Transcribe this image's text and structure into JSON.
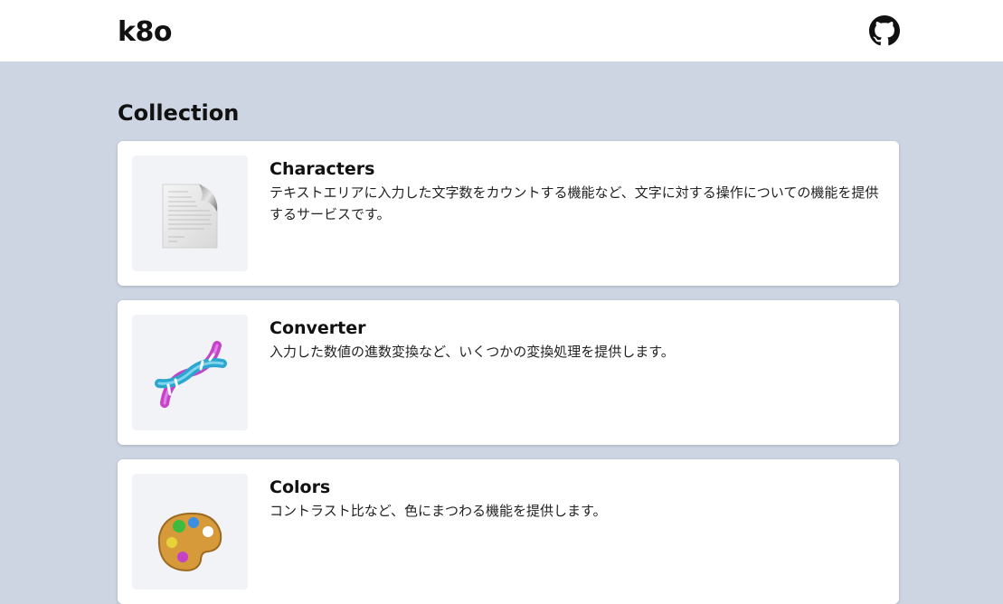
{
  "header": {
    "logo": "k8o",
    "github_icon": "github-icon"
  },
  "main": {
    "section_title": "Collection",
    "cards": [
      {
        "title": "Characters",
        "description": "テキストエリアに入力した文字数をカウントする機能など、文字に対する操作についての機能を提供するサービスです。",
        "icon": "document-icon"
      },
      {
        "title": "Converter",
        "description": "入力した数値の進数変換など、いくつかの変換処理を提供します。",
        "icon": "dna-icon"
      },
      {
        "title": "Colors",
        "description": "コントラスト比など、色にまつわる機能を提供します。",
        "icon": "palette-icon"
      }
    ]
  }
}
